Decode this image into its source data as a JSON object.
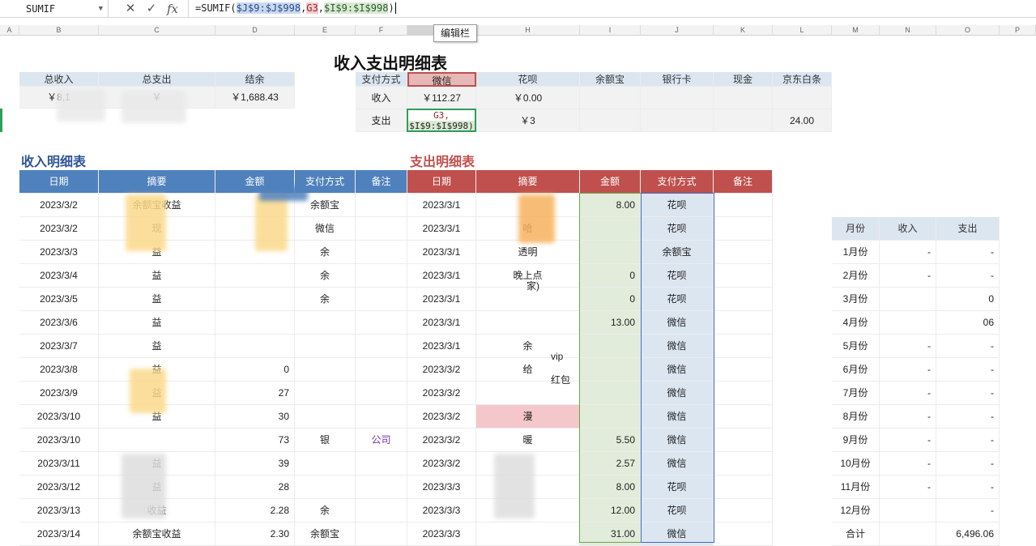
{
  "formula_bar": {
    "name_box": "SUMIF",
    "cancel_icon": "✕",
    "confirm_icon": "✓",
    "fx_icon": "fx",
    "formula_prefix": "=SUMIF(",
    "ref_1": "$J$9:$J$998",
    "comma_1": ",",
    "ref_2": "G3",
    "comma_2": ",",
    "ref_3": "$I$9:$I$998",
    "formula_suffix": ")",
    "tooltip": "编辑栏"
  },
  "columns": [
    "A",
    "B",
    "C",
    "D",
    "E",
    "F",
    "G",
    "H",
    "I",
    "J",
    "K",
    "L",
    "M",
    "N",
    "O",
    "P"
  ],
  "title": "收入支出明细表",
  "summary": {
    "headers": [
      "总收入",
      "总支出",
      "结余"
    ],
    "values": [
      "￥8,1",
      "￥",
      "￥1,688.43"
    ]
  },
  "payment_table": {
    "header_label": "支付方式",
    "methods": [
      "微信",
      "花呗",
      "余额宝",
      "银行卡",
      "现金",
      "京东白条"
    ],
    "income_label": "收入",
    "expense_label": "支出",
    "income_values": [
      "￥112.27",
      "￥0.00",
      "",
      "",
      "",
      ""
    ],
    "expense_values": [
      "",
      "￥3",
      "",
      "",
      "",
      "24.00"
    ],
    "editing_cell_line1": "G3,",
    "editing_cell_line2": "$I$9:$I$998)"
  },
  "income_section": {
    "title": "收入明细表",
    "headers": [
      "日期",
      "摘要",
      "金额",
      "支付方式",
      "备注"
    ],
    "rows": [
      [
        "2023/3/2",
        "余额宝收益",
        "",
        "余额宝",
        ""
      ],
      [
        "2023/3/2",
        "现",
        "",
        "微信",
        ""
      ],
      [
        "2023/3/3",
        "益",
        "",
        "余",
        ""
      ],
      [
        "2023/3/4",
        "益",
        "",
        "余",
        ""
      ],
      [
        "2023/3/5",
        "益",
        "",
        "余",
        ""
      ],
      [
        "2023/3/6",
        "益",
        "",
        "",
        ""
      ],
      [
        "2023/3/7",
        "益",
        "",
        "",
        ""
      ],
      [
        "2023/3/8",
        "益",
        "0",
        "",
        ""
      ],
      [
        "2023/3/9",
        "益",
        "27",
        "",
        ""
      ],
      [
        "2023/3/10",
        "益",
        "30",
        "",
        ""
      ],
      [
        "2023/3/10",
        "",
        "73",
        "银",
        "公司"
      ],
      [
        "2023/3/11",
        "益",
        "39",
        "",
        ""
      ],
      [
        "2023/3/12",
        "益",
        "28",
        "",
        ""
      ],
      [
        "2023/3/13",
        "收益",
        "2.28",
        "余",
        ""
      ],
      [
        "2023/3/14",
        "余额宝收益",
        "2.30",
        "余额宝",
        ""
      ]
    ]
  },
  "expense_section": {
    "title": "支出明细表",
    "headers": [
      "日期",
      "摘要",
      "金额",
      "支付方式",
      "备注"
    ],
    "rows": [
      [
        "2023/3/1",
        "",
        "8.00",
        "花呗",
        ""
      ],
      [
        "2023/3/1",
        "哈",
        "",
        "花呗",
        ""
      ],
      [
        "2023/3/1",
        "透明",
        "",
        "余额宝",
        ""
      ],
      [
        "2023/3/1",
        "晚上点",
        "0",
        "花呗",
        ""
      ],
      [
        "2023/3/1",
        "",
        "0",
        "花呗",
        ""
      ],
      [
        "2023/3/1",
        "",
        "13.00",
        "微信",
        ""
      ],
      [
        "2023/3/1",
        "余",
        "",
        "微信",
        ""
      ],
      [
        "2023/3/2",
        "给",
        "",
        "微信",
        ""
      ],
      [
        "2023/3/2",
        "",
        "",
        "微信",
        ""
      ],
      [
        "2023/3/2",
        "漫",
        "",
        "微信",
        ""
      ],
      [
        "2023/3/2",
        "暖",
        "5.50",
        "微信",
        ""
      ],
      [
        "2023/3/2",
        "",
        "2.57",
        "微信",
        ""
      ],
      [
        "2023/3/3",
        "",
        "8.00",
        "花呗",
        ""
      ],
      [
        "2023/3/3",
        "",
        "12.00",
        "花呗",
        ""
      ],
      [
        "2023/3/3",
        "",
        "31.00",
        "微信",
        ""
      ]
    ],
    "extra_fragments": [
      "家)",
      "vip",
      "红包"
    ]
  },
  "monthly": {
    "headers": [
      "月份",
      "收入",
      "支出"
    ],
    "rows": [
      [
        "1月份",
        "-",
        "-"
      ],
      [
        "2月份",
        "-",
        "-"
      ],
      [
        "3月份",
        "",
        "0"
      ],
      [
        "4月份",
        "",
        "06"
      ],
      [
        "5月份",
        "-",
        "-"
      ],
      [
        "6月份",
        "-",
        "-"
      ],
      [
        "7月份",
        "-",
        "-"
      ],
      [
        "8月份",
        "-",
        "-"
      ],
      [
        "9月份",
        "-",
        "-"
      ],
      [
        "10月份",
        "-",
        "-"
      ],
      [
        "11月份",
        "-",
        "-"
      ],
      [
        "12月份",
        "",
        "-"
      ],
      [
        "合计",
        "",
        "6,496.06"
      ]
    ]
  }
}
